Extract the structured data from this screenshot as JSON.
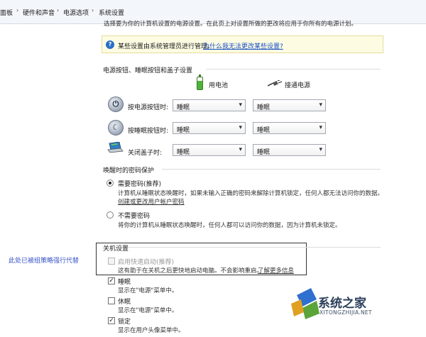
{
  "breadcrumb": {
    "items": [
      "面板",
      "硬件和声音",
      "电源选项",
      "系统设置"
    ],
    "separator": "›"
  },
  "intro_text": "选择要为你的计算机设置的电源设置。在此页上对设置所做的更改将应用于你所有的电源计划。",
  "admin_banner": {
    "text": "某些设置由系统管理员进行管理。",
    "link": "为什么我无法更改某些设置?",
    "icon": "shield-info-icon"
  },
  "buttons_section": {
    "title": "电源按钮、睡眠按钮和盖子设置",
    "col_battery": "用电池",
    "col_plugged": "接通电源",
    "rows": [
      {
        "label": "按电源按钮时:",
        "battery": "睡眠",
        "plugged": "睡眠",
        "icon": "power-button-icon"
      },
      {
        "label": "按睡眠按钮时:",
        "battery": "睡眠",
        "plugged": "睡眠",
        "icon": "sleep-button-icon"
      },
      {
        "label": "关闭盖子时:",
        "battery": "睡眠",
        "plugged": "睡眠",
        "icon": "laptop-lid-icon"
      }
    ]
  },
  "password_section": {
    "title": "唤醒时的密码保护",
    "require": {
      "title": "需要密码(推荐)",
      "desc1": "计算机从睡眠状态唤醒时，如果未输入正确的密码来解除计算机锁定，任何人都无法访问你的数据。",
      "link": "创建或更改用户帐户密码",
      "selected": true
    },
    "norequire": {
      "title": "不需要密码",
      "desc": "将你的计算机从睡眠状态唤醒时，任何人都可以访问你的数据，因为计算机未锁定。",
      "selected": false
    }
  },
  "shutdown_section": {
    "title": "关机设置",
    "policy_note": "此处已被组策略强行代替",
    "fast_startup": {
      "title": "启用快速启动(推荐)",
      "desc": "这有助于在关机之后更快地启动电脑。不会影响重启。",
      "link": "了解更多信息",
      "checked": false,
      "disabled": true
    },
    "items": [
      {
        "title": "睡眠",
        "desc": "显示在\"电源\"菜单中。",
        "checked": true
      },
      {
        "title": "休眠",
        "desc": "显示在\"电源\"菜单中。",
        "checked": false
      },
      {
        "title": "锁定",
        "desc": "显示在用户头像菜单中。",
        "checked": true
      }
    ]
  },
  "watermark": {
    "name": "系统之家",
    "url": "XITONGZHIJIA.NET"
  }
}
